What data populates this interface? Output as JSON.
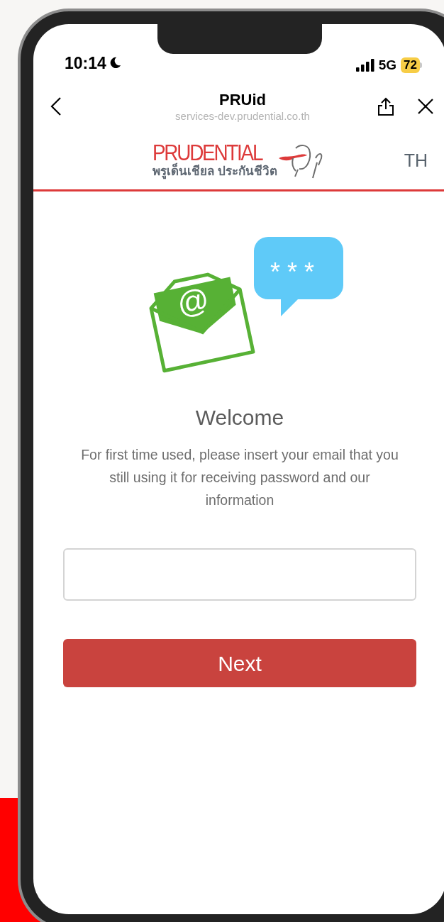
{
  "status_bar": {
    "time": "10:14",
    "network": "5G",
    "battery": "72"
  },
  "browser_bar": {
    "title": "PRUid",
    "url": "services-dev.prudential.co.th"
  },
  "header": {
    "logo": {
      "wordmark": "PRUDENTIAL",
      "tagline": "พรูเด็นเชียล ประกันชีวิต"
    },
    "language": "TH"
  },
  "illustration": {
    "envelope_symbol": "@",
    "bubble_text": "* * *"
  },
  "welcome": {
    "title": "Welcome",
    "message": "For first time used, please insert your email that you still using it for receiving password and our information"
  },
  "next_button": {
    "label": "Next"
  }
}
